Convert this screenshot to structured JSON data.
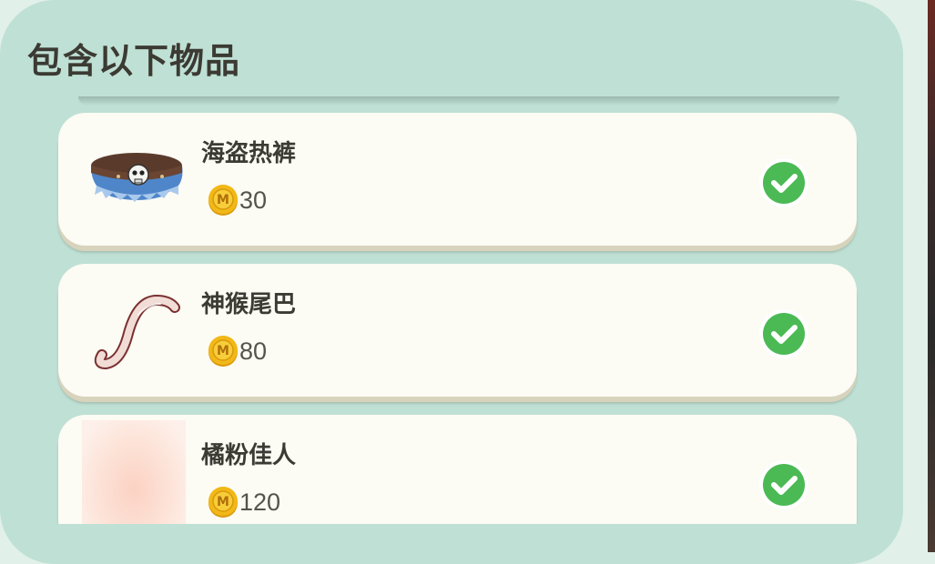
{
  "panel": {
    "title": "包含以下物品"
  },
  "items": [
    {
      "name": "海盗热裤",
      "price": "30",
      "icon": "pirate-shorts-icon",
      "owned": true
    },
    {
      "name": "神猴尾巴",
      "price": "80",
      "icon": "monkey-tail-icon",
      "owned": true
    },
    {
      "name": "橘粉佳人",
      "price": "120",
      "icon": "orange-pink-beauty-icon",
      "owned": true
    }
  ],
  "colors": {
    "panel_bg": "#bfe0d5",
    "card_bg": "#fcfbf4",
    "check_green": "#4bba54",
    "coin_gold": "#f2b817",
    "title_text": "#3b3a33"
  }
}
